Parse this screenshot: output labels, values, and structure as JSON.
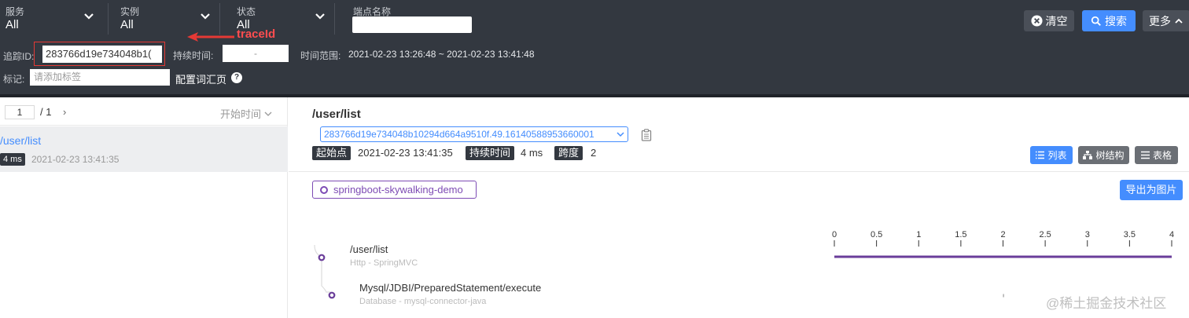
{
  "filters": {
    "service": {
      "label": "服务",
      "value": "All"
    },
    "instance": {
      "label": "实例",
      "value": "All"
    },
    "status": {
      "label": "状态",
      "value": "All"
    },
    "endpoint": {
      "label": "端点名称",
      "value": ""
    }
  },
  "actions": {
    "clear": "清空",
    "search": "搜索",
    "more": "更多"
  },
  "search": {
    "trace_id_label": "追踪ID:",
    "trace_id_value": "283766d19e734048b1(",
    "duration_label": "持续时间:",
    "duration_value": "-",
    "time_range_label": "时间范围:",
    "time_range_value": "2021-02-23 13:26:48 ~ 2021-02-23 13:41:48",
    "tag_label": "标记:",
    "tag_placeholder": "请添加标签",
    "vocab_link": "配置词汇页",
    "help_icon": "?"
  },
  "annotation": {
    "text": "traceId",
    "color": "#ff4d4f"
  },
  "list": {
    "page_current": "1",
    "page_total": "/ 1",
    "page_next": "›",
    "sort_label": "开始时间",
    "items": [
      {
        "name": "/user/list",
        "duration": "4 ms",
        "start": "2021-02-23 13:41:35"
      }
    ]
  },
  "detail": {
    "title": "/user/list",
    "trace_id": "283766d19e734048b10294d664a9510f.49.16140588953660001",
    "start_label": "起始点",
    "start_value": "2021-02-23 13:41:35",
    "duration_label": "持续时间",
    "duration_value": "4 ms",
    "span_label": "跨度",
    "span_value": "2",
    "views": {
      "list": "列表",
      "tree": "树结构",
      "table": "表格"
    },
    "service_chip": "springboot-skywalking-demo",
    "export": "导出为图片"
  },
  "timeline": {
    "ticks": [
      "0",
      "0.5",
      "1",
      "1.5",
      "2",
      "2.5",
      "3",
      "3.5",
      "4"
    ],
    "tick_values": [
      0,
      0.5,
      1,
      1.5,
      2,
      2.5,
      3,
      3.5,
      4
    ],
    "max": 4,
    "spans": [
      {
        "name": "/user/list",
        "sub": "Http - SpringMVC",
        "start": 0,
        "end": 4,
        "color": "#6a3d9a"
      },
      {
        "name": "Mysql/JDBI/PreparedStatement/execute",
        "sub": "Database - mysql-connector-java",
        "start": 2,
        "end": 2,
        "color": "#6a3d9a"
      }
    ]
  },
  "watermark": "@稀土掘金技术社区",
  "colors": {
    "accent": "#448dfe",
    "dark": "#333840",
    "purple": "#7d4bb4",
    "annotation": "#e53935"
  }
}
